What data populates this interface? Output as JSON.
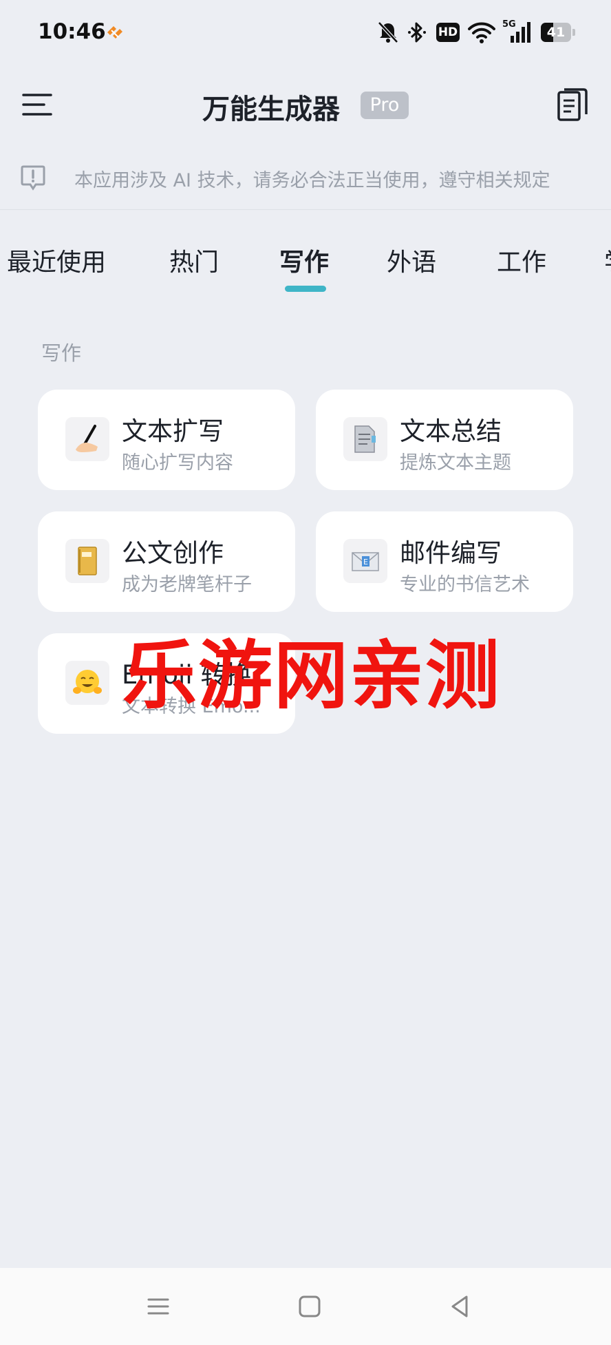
{
  "status_bar": {
    "time": "10:46",
    "hd_label": "HD",
    "network_label": "5G",
    "battery_level": "41",
    "icons": [
      "app-badge-icon",
      "mute-bell-icon",
      "bluetooth-icon",
      "wifi-icon",
      "signal-icon",
      "battery-icon"
    ]
  },
  "header": {
    "title": "万能生成器",
    "badge": "Pro",
    "left_icon": "menu-icon",
    "right_icon": "history-icon"
  },
  "notice": {
    "icon": "notice-icon",
    "text": "本应用涉及 AI 技术，请务必合法正当使用，遵守相关规定"
  },
  "tabs": {
    "items": [
      {
        "label": "最近使用"
      },
      {
        "label": "热门"
      },
      {
        "label": "写作"
      },
      {
        "label": "外语"
      },
      {
        "label": "工作"
      },
      {
        "label": "学"
      }
    ],
    "active_index": 2,
    "active_color": "#3fb5c7"
  },
  "section": {
    "title": "写作",
    "cards": [
      {
        "title": "文本扩写",
        "subtitle": "随心扩写内容",
        "icon": "writing-hand-icon"
      },
      {
        "title": "文本总结",
        "subtitle": "提炼文本主题",
        "icon": "document-icon"
      },
      {
        "title": "公文创作",
        "subtitle": "成为老牌笔杆子",
        "icon": "notebook-icon"
      },
      {
        "title": "邮件编写",
        "subtitle": "专业的书信艺术",
        "icon": "envelope-icon"
      },
      {
        "title": "Emoji 转换",
        "subtitle": "文本转换 Emo...",
        "icon": "hugging-face-icon"
      }
    ]
  },
  "watermark": {
    "text": "乐游网亲测",
    "color": "#f0140f"
  },
  "nav_bar": {
    "icons": [
      "recents-icon",
      "home-icon",
      "back-icon"
    ]
  }
}
